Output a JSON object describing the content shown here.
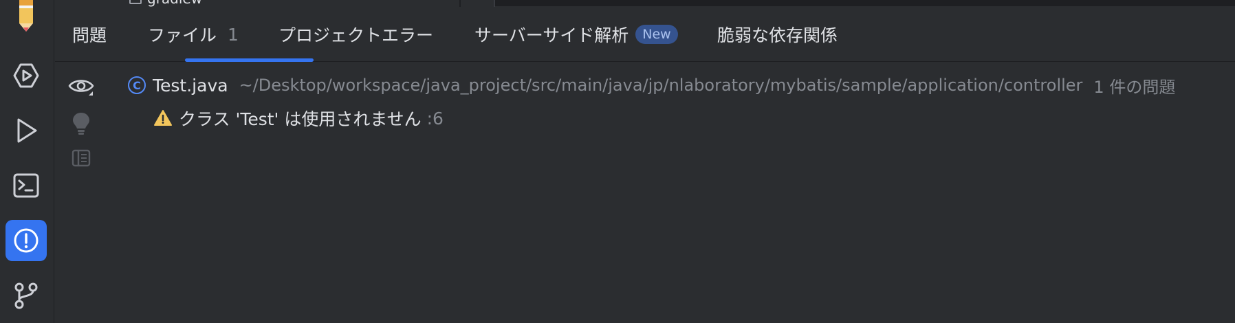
{
  "top_strip": {
    "file_label": "gradlew"
  },
  "activity_bar": {
    "items": [
      {
        "name": "pencil-icon"
      },
      {
        "name": "services-icon"
      },
      {
        "name": "run-icon"
      },
      {
        "name": "terminal-icon"
      },
      {
        "name": "problems-icon",
        "active": true
      },
      {
        "name": "git-icon"
      }
    ]
  },
  "tabs": {
    "title": "問題",
    "file_tab": {
      "label": "ファイル",
      "count": "1"
    },
    "project_errors": {
      "label": "プロジェクトエラー"
    },
    "server_side": {
      "label": "サーバーサイド解析",
      "badge": "New"
    },
    "vulnerable_deps": {
      "label": "脆弱な依存関係"
    }
  },
  "tree": {
    "file": {
      "name": "Test.java",
      "path": "~/Desktop/workspace/java_project/src/main/java/jp/nlaboratory/mybatis/sample/application/controller",
      "count": "1 件の問題",
      "icon": "C"
    },
    "problems": [
      {
        "text": "クラス 'Test' は使用されません",
        "line": ":6"
      }
    ]
  },
  "colors": {
    "background": "#2b2d30",
    "accent": "#3574f0",
    "text": "#dfe1e5",
    "muted": "#868a91",
    "warning": "#f2c55c",
    "class_icon": "#548af7"
  }
}
